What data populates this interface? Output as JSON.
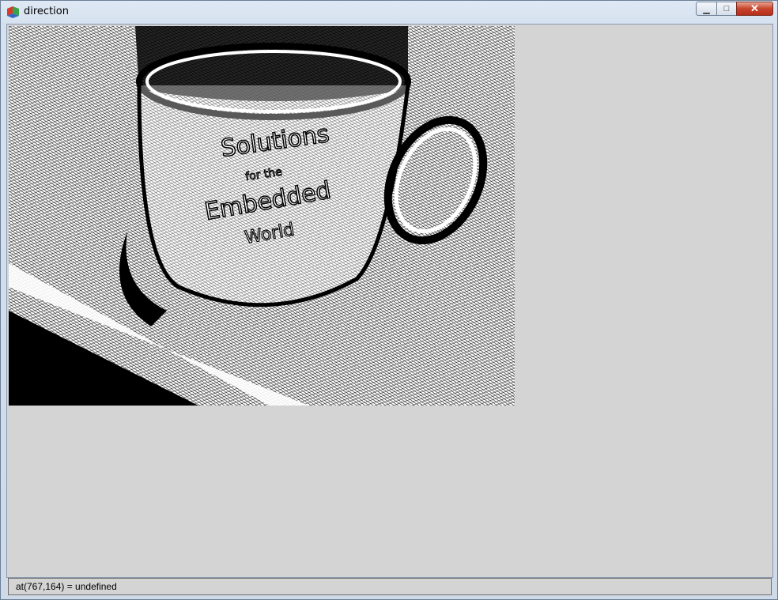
{
  "window": {
    "title": "direction",
    "app_icon": "gtk-icon",
    "controls": {
      "minimize_icon": "minimize-icon",
      "maximize_icon": "maximize-icon",
      "close_icon": "close-icon",
      "minimize_glyph": "▁",
      "maximize_glyph": "□",
      "close_glyph": "✕"
    }
  },
  "image": {
    "description_icon": "processed-image",
    "mug_text": [
      "Solutions",
      "for the",
      "Embedded",
      "World"
    ]
  },
  "status": {
    "text": "at(767,164) = undefined"
  },
  "colors": {
    "client_bg": "#d4d4d4",
    "close_button": "#c7442b"
  }
}
